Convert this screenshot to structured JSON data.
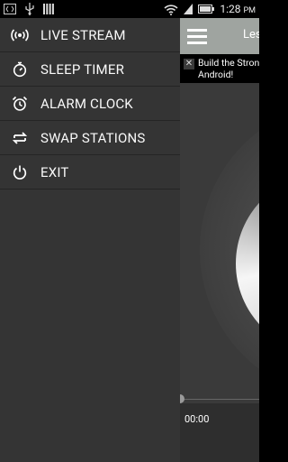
{
  "status_bar": {
    "time": "1:28",
    "ampm": "PM",
    "icons": [
      "code-icon",
      "usb-icon",
      "bars-icon",
      "wifi-icon",
      "signal-icon",
      "battery-icon"
    ]
  },
  "drawer": {
    "items": [
      {
        "label": "LIVE STREAM",
        "icon": "radio-waves-icon"
      },
      {
        "label": "SLEEP TIMER",
        "icon": "timer-icon"
      },
      {
        "label": "ALARM CLOCK",
        "icon": "alarm-clock-icon"
      },
      {
        "label": "SWAP STATIONS",
        "icon": "swap-icon"
      },
      {
        "label": "EXIT",
        "icon": "power-icon"
      }
    ]
  },
  "app": {
    "title": "Les",
    "ad_line1": "Build the Stron",
    "ad_line2": "Android!",
    "ad_close": "✕",
    "elapsed_time": "00:00",
    "progress": 0
  },
  "colors": {
    "drawer_bg": "#343434",
    "header_bg": "#9fa4a0",
    "divider": "#242424"
  }
}
